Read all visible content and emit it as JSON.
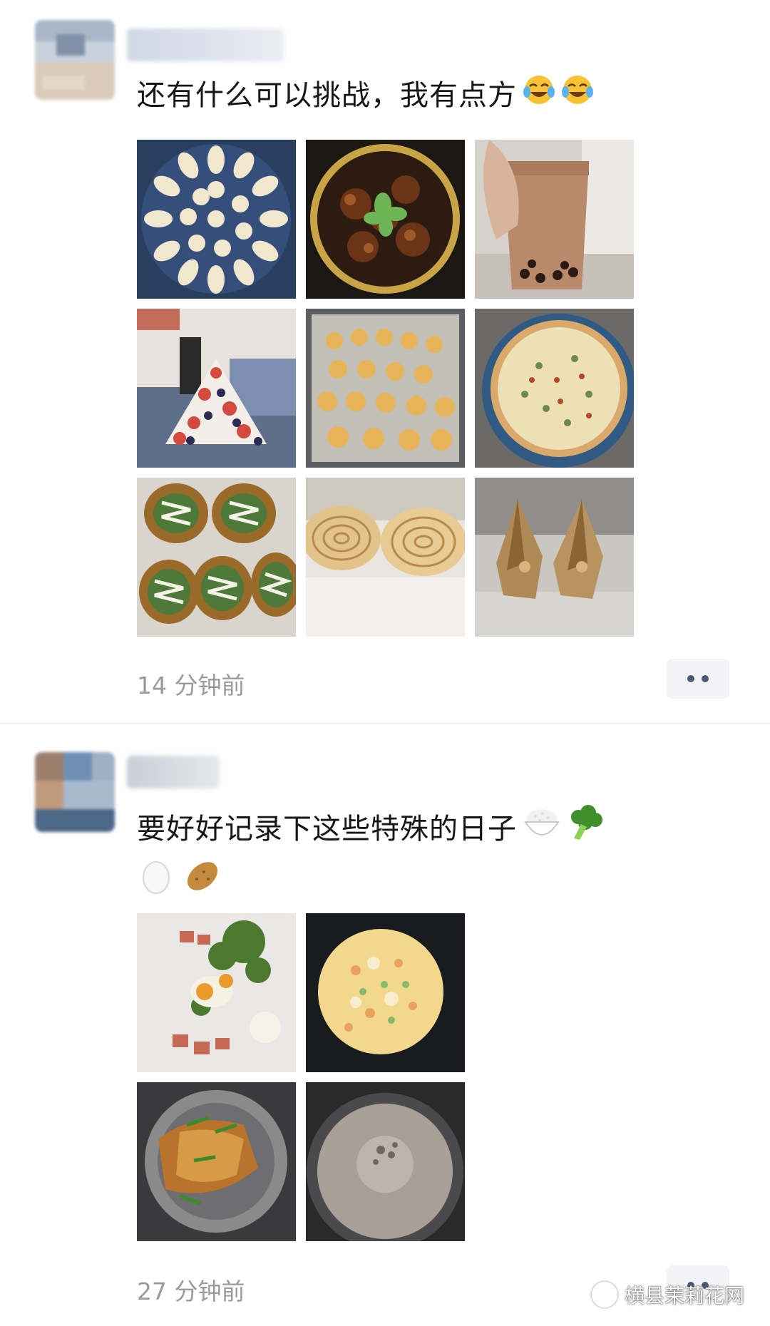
{
  "posts": [
    {
      "text": "还有什么可以挑战，我有点方",
      "emojis": [
        "tears-of-joy-emoji",
        "tears-of-joy-emoji"
      ],
      "time": "14 分钟前",
      "photos": [
        "piped-dumplings-plate-photo",
        "braised-chicken-pot-photo",
        "bubble-tea-glass-photo",
        "fruit-tree-cake-photo",
        "piped-cookies-tray-photo",
        "homemade-pizza-photo",
        "mayo-topped-buns-photo",
        "swirl-bread-loaf-photo",
        "paper-heels-craft-photo"
      ]
    },
    {
      "text": "要好好记录下这些特殊的日子",
      "emojis": [
        "rice-bowl-emoji",
        "broccoli-emoji",
        "egg-emoji",
        "potato-emoji"
      ],
      "time": "27 分钟前",
      "photos": [
        "egg-ham-greens-prep-photo",
        "vegetable-omelette-pan-photo",
        "pan-fried-fish-photo",
        "soup-in-pot-photo"
      ]
    }
  ],
  "watermark": {
    "text": "横县茉莉花网",
    "icon": "wechat-channel-icon"
  },
  "colors": {
    "time_gray": "#9b9b9b",
    "more_dots": "#4e5a73",
    "divider": "#eeeeee"
  }
}
